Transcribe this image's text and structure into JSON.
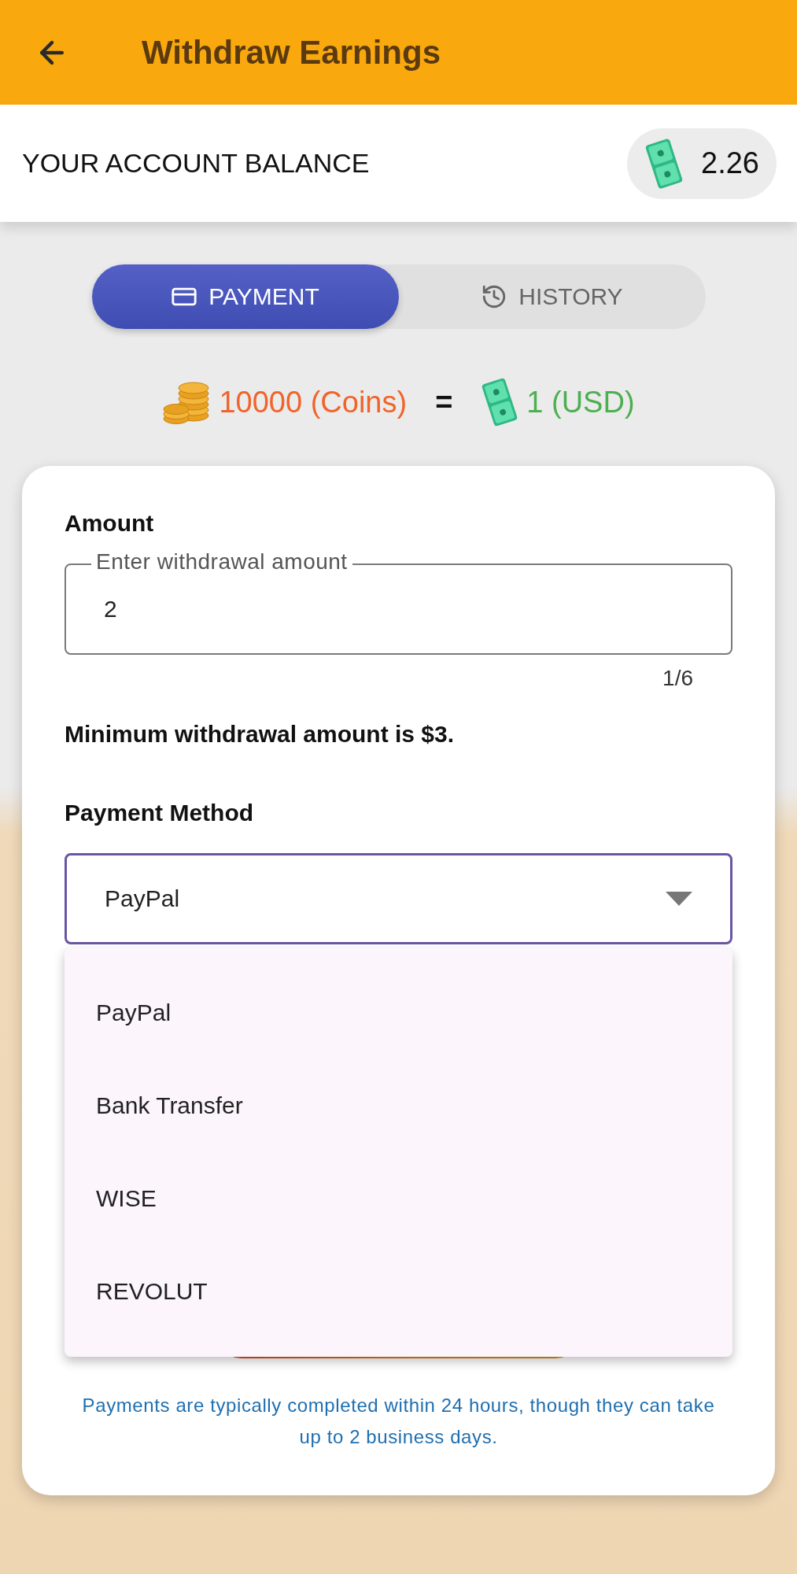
{
  "header": {
    "title": "Withdraw Earnings"
  },
  "balance": {
    "label": "YOUR ACCOUNT BALANCE",
    "amount": "2.26"
  },
  "tabs": [
    {
      "label": "PAYMENT",
      "selected": true
    },
    {
      "label": "HISTORY",
      "selected": false
    }
  ],
  "rate": {
    "coins": "10000 (Coins)",
    "equals": "=",
    "usd": "1 (USD)"
  },
  "form": {
    "amount_label": "Amount",
    "amount_field": {
      "label": "Enter withdrawal amount",
      "value": "2",
      "counter": "1/6"
    },
    "minimum_note": "Minimum withdrawal amount is $3.",
    "method_label": "Payment Method",
    "method_select": {
      "value": "PayPal",
      "expanded": true,
      "options": [
        {
          "label": "PayPal"
        },
        {
          "label": "Bank Transfer"
        },
        {
          "label": "WISE"
        },
        {
          "label": "REVOLUT"
        }
      ]
    },
    "footer_note": "Payments are typically completed within 24 hours, though they can take up to 2 business days."
  }
}
